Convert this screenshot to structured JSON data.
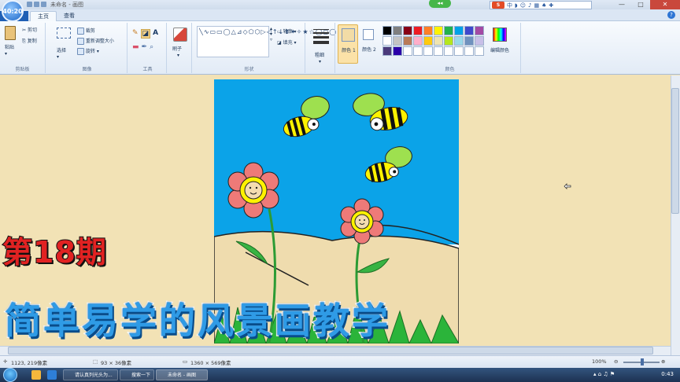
{
  "titlebar": {
    "clock_badge": "40:20",
    "window_title": "未命名 - 画图",
    "ime_logo": "S",
    "ime_lang": "中"
  },
  "tabs": [
    {
      "label": "主页",
      "active": true
    },
    {
      "label": "查看",
      "active": false
    }
  ],
  "ribbon": {
    "clipboard": {
      "paste": "粘贴",
      "cut": "剪切",
      "copy": "复制",
      "label": "剪贴板"
    },
    "image": {
      "select": "选择",
      "crop": "裁剪",
      "resize": "重新调整大小",
      "rotate": "旋转",
      "label": "图像"
    },
    "tools": {
      "label": "工具"
    },
    "brushes": {
      "label": "刷子"
    },
    "shapes": {
      "outline": "轮廓",
      "fill": "填充",
      "label": "形状"
    },
    "size": {
      "label": "粗细"
    },
    "color1": {
      "label": "颜色 1",
      "value": "#f2dca6"
    },
    "color2": {
      "label": "颜色 2",
      "value": "#ffffff"
    },
    "colors": {
      "label": "颜色",
      "edit_label": "编辑颜色",
      "palette_row1": [
        "#000000",
        "#7f7f7f",
        "#880015",
        "#ed1c24",
        "#ff7f27",
        "#fff200",
        "#22b14c",
        "#00a2e8",
        "#3f48cc",
        "#a349a4"
      ],
      "palette_row2": [
        "#ffffff",
        "#c3c3c3",
        "#b97a57",
        "#ffaec9",
        "#ffc90e",
        "#efe4b0",
        "#b5e61d",
        "#99d9ea",
        "#7092be",
        "#c8bfe7"
      ],
      "palette_row3": [
        "#4a3a7a",
        "#2b00a8",
        "#ffffff",
        "#ffffff",
        "#ffffff",
        "#ffffff",
        "#ffffff",
        "#ffffff",
        "#ffffff",
        "#ffffff"
      ]
    }
  },
  "statusbar": {
    "cursor_pos": "1123, 219像素",
    "selection_size": "93 × 36像素",
    "image_size": "1360 × 569像素",
    "zoom": "100%"
  },
  "taskbar": {
    "item1": "请认真列光头为...",
    "item2": "搜索一下",
    "item3": "未命名 - 画图",
    "clock": "0:43"
  },
  "overlay": {
    "episode": "第18期",
    "subtitle": "简单易学的风景画教学"
  }
}
